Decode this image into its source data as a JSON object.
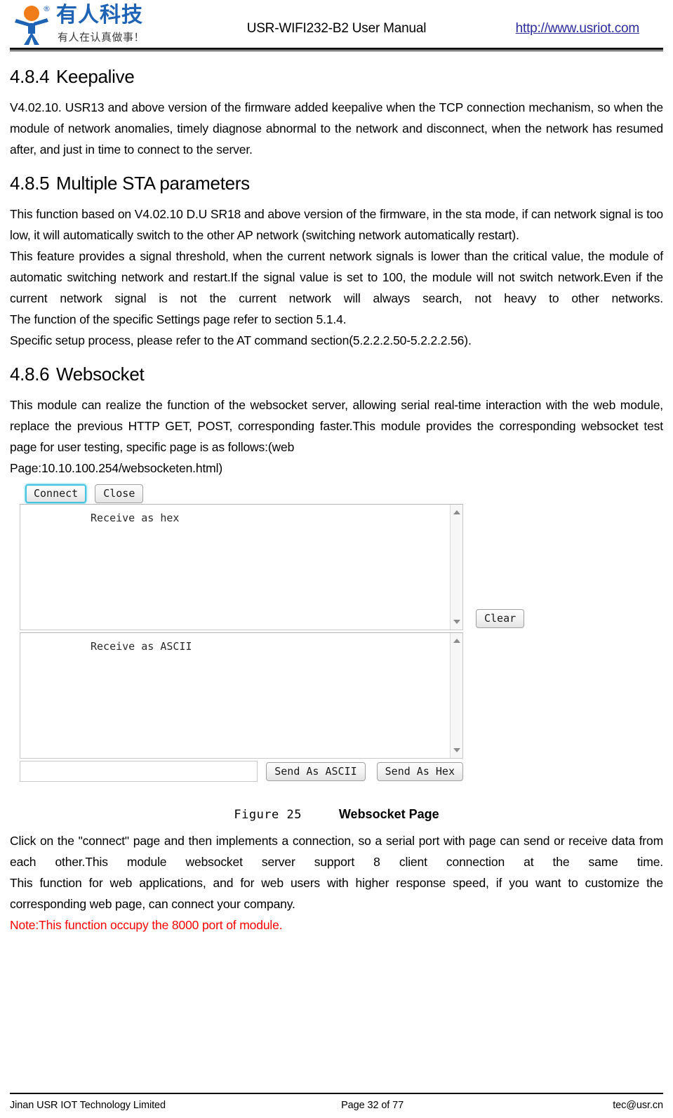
{
  "header": {
    "logo_cn_main": "有人科技",
    "logo_cn_sub": "有人在认真做事！",
    "logo_registered": "®",
    "title": "USR-WIFI232-B2 User Manual",
    "link": "http://www.usriot.com",
    "link_color": "#2b2b9c"
  },
  "sections": {
    "keepalive": {
      "number": "4.8.4",
      "title": "Keepalive",
      "paragraph": "V4.02.10. USR13 and above version of the firmware added keepalive when the TCP connection mechanism, so when the module of network anomalies, timely diagnose abnormal to the network and disconnect, when the network has resumed after, and just in time to connect to the server."
    },
    "multiple_sta": {
      "number": "4.8.5",
      "title": "Multiple STA parameters",
      "paragraph_1": "This function based on V4.02.10 D.U SR18 and above version of the firmware, in the sta mode, if can network signal is too low, it will automatically switch to the other AP network (switching network automatically restart).",
      "paragraph_2": "This feature provides a signal threshold, when the current network signals is lower than the critical value, the module of automatic switching network and restart.If the signal value is set to 100, the module will not switch network.Even if the current network signal is not the current network will always search, not heavy to other networks.",
      "paragraph_3": "The function of the specific Settings page refer to section 5.1.4.",
      "paragraph_4": "Specific setup process, please refer to the AT command section(5.2.2.2.50-5.2.2.2.56)."
    },
    "websocket": {
      "number": "4.8.6",
      "title": "Websocket",
      "paragraph_1": "This module can realize the function of the websocket server, allowing serial real-time interaction with the web module, replace the previous HTTP GET, POST, corresponding faster.This module provides the corresponding websocket test page for user testing, specific page is as follows:(web",
      "paragraph_1_cont": " Page:10.10.100.254/websocketen.html)",
      "paragraph_2": "Click on the \"connect\" page and then implements a connection, so a serial port with page can send or receive data from each other.This module websocket server support 8 client connection at the same time.",
      "paragraph_3": "This function for web applications, and for web users with higher response speed, if you want to customize the corresponding web page, can connect your company.",
      "note": "Note:This function occupy the 8000 port of module.",
      "note_color": "#ff0000"
    }
  },
  "figure": {
    "number": "Figure 25",
    "title": "Websocket Page",
    "websocket_page": {
      "connect_button": "Connect",
      "close_button": "Close",
      "receive_hex_label": "Receive as hex",
      "receive_ascii_label": "Receive as ASCII",
      "clear_button": "Clear",
      "send_ascii_button": "Send As ASCII",
      "send_hex_button": "Send As Hex",
      "send_input_value": "",
      "focus_ring_color": "#45c3e0"
    }
  },
  "footer": {
    "company": "Jinan USR IOT Technology Limited",
    "page": "Page 32 of 77",
    "email": "tec@usr.cn"
  }
}
